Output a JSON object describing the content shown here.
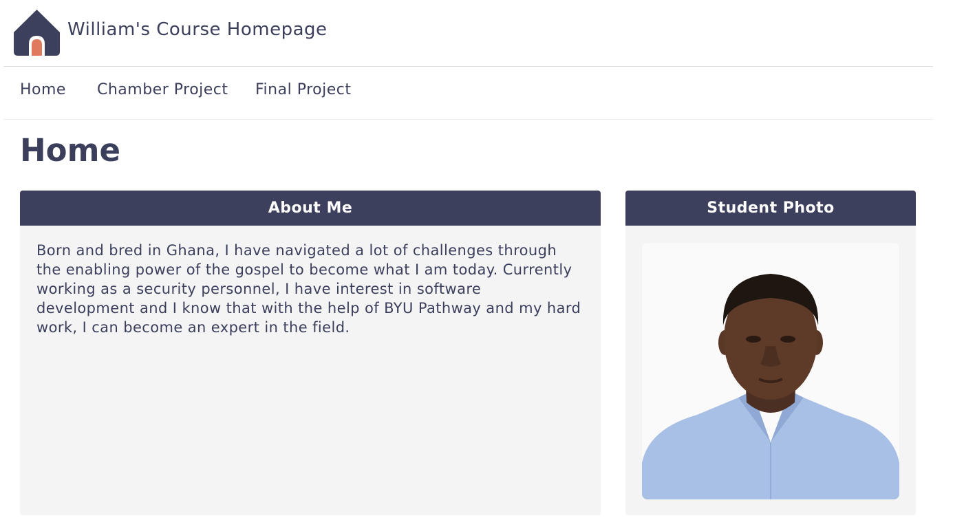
{
  "header": {
    "title": "William's Course Homepage",
    "logo_icon": "house-icon",
    "colors": {
      "primary": "#3d405d",
      "accent": "#e07a5f"
    }
  },
  "nav": {
    "items": [
      {
        "label": "Home"
      },
      {
        "label": "Chamber Project"
      },
      {
        "label": "Final Project"
      }
    ]
  },
  "main": {
    "page_title": "Home",
    "about": {
      "heading": "About Me",
      "text": "Born and bred in Ghana, I have navigated a lot of challenges through the enabling power of the gospel to become what I am today. Currently working as a security personnel, I have interest in software development and I know that with the help of BYU Pathway and my hard work, I can become an expert in the field."
    },
    "photo": {
      "heading": "Student Photo"
    }
  }
}
